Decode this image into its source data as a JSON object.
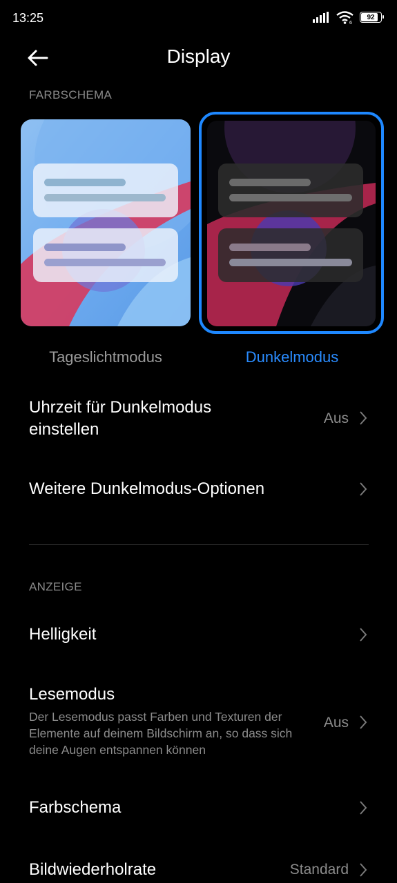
{
  "status": {
    "time": "13:25",
    "battery": "92"
  },
  "header": {
    "title": "Display"
  },
  "sections": {
    "color_scheme": "FARBSCHEMA",
    "display": "ANZEIGE"
  },
  "themes": {
    "light_label": "Tageslichtmodus",
    "dark_label": "Dunkelmodus",
    "selected": "dark"
  },
  "rows": {
    "dark_schedule": {
      "title": "Uhrzeit für Dunkelmodus einstellen",
      "value": "Aus"
    },
    "more_dark_options": {
      "title": "Weitere Dunkelmodus-Optionen"
    },
    "brightness": {
      "title": "Helligkeit"
    },
    "reading_mode": {
      "title": "Lesemodus",
      "desc": "Der Lesemodus passt Farben und Texturen der Elemente auf deinem Bildschirm an, so dass sich deine Augen entspannen können",
      "value": "Aus"
    },
    "color_scheme": {
      "title": "Farbschema"
    },
    "refresh_rate": {
      "title": "Bildwiederholrate",
      "value": "Standard"
    }
  },
  "colors": {
    "accent": "#1e88ff",
    "background": "#000000",
    "secondary_text": "#8c8c8c"
  }
}
